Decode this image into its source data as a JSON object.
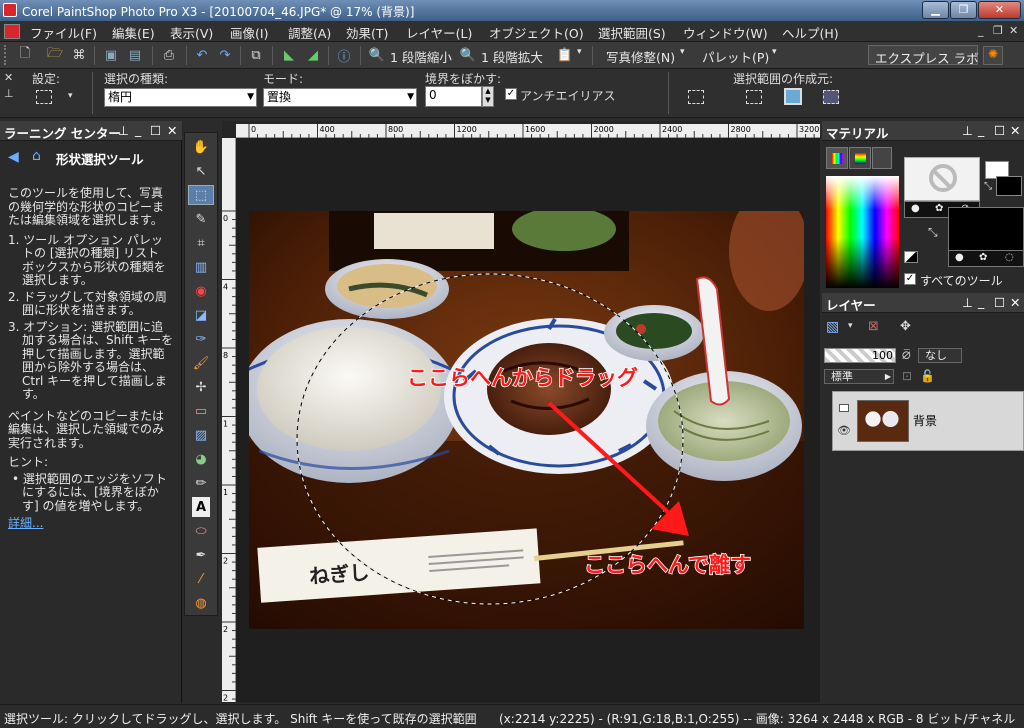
{
  "window": {
    "title": "Corel PaintShop Photo Pro X3 - [20100704_46.JPG* @  17% (背景)]",
    "minimize_icon": "minimize-icon",
    "maximize_icon": "maximize-icon",
    "close_icon": "close-icon"
  },
  "menu": {
    "items": [
      "ファイル(F)",
      "編集(E)",
      "表示(V)",
      "画像(I)",
      "調整(A)",
      "効果(T)",
      "レイヤー(L)",
      "オブジェクト(O)",
      "選択範囲(S)",
      "ウィンドウ(W)",
      "ヘルプ(H)"
    ]
  },
  "toolbar": {
    "zoom_out": "1 段階縮小",
    "zoom_in": "1 段階拡大",
    "photo_fix": "写真修整(N)",
    "palette": "パレット(P)",
    "express_lab": "エクスプレス ラボ"
  },
  "options": {
    "presets_label": "設定:",
    "selection_type_label": "選択の種類:",
    "selection_type_value": "楕円",
    "mode_label": "モード:",
    "mode_value": "置換",
    "feather_label": "境界をぼかす:",
    "feather_value": "0",
    "antialias_label": "アンチエイリアス",
    "antialias_checked": true,
    "create_from_label": "選択範囲の作成元:"
  },
  "learning": {
    "header": "ラーニング センター",
    "title": "形状選択ツール",
    "intro": "このツールを使用して、写真の幾何学的な形状のコピーまたは編集領域を選択します。",
    "steps": [
      "1. ツール オプション パレットの [選択の種類] リスト ボックスから形状の種類を選択します。",
      "2. ドラッグして対象領域の周囲に形状を描きます。",
      "3. オプション: 選択範囲に追加する場合は、Shift キーを押して描画します。選択範囲から除外する場合は、Ctrl キーを押して描画します。"
    ],
    "note": "ペイントなどのコピーまたは編集は、選択した領域でのみ実行されます。",
    "hint_label": "ヒント:",
    "hint": "選択範囲のエッジをソフトにするには、[境界をぼかす] の値を増やします。",
    "more_link": "詳細..."
  },
  "ruler": {
    "h_ticks": [
      "0",
      "400",
      "800",
      "1200",
      "1600",
      "2000",
      "2400",
      "2800",
      "3200"
    ],
    "v_ticks": [
      "0",
      "4",
      "8",
      "1",
      "1",
      "2",
      "2",
      "2"
    ]
  },
  "canvas": {
    "annotation_drag": "ここらへんからドラッグ",
    "annotation_release": "ここらへんで離す",
    "chopsticks_brand": "ねぎし"
  },
  "materials": {
    "header": "マテリアル",
    "all_tools_label": "すべてのツール",
    "all_tools_checked": true
  },
  "layers": {
    "header": "レイヤー",
    "opacity": "100",
    "blend_none": "なし",
    "blend_mode": "標準",
    "layer_name": "背景"
  },
  "status": {
    "text": "選択ツール: クリックしてドラッグし、選択します。 Shift キーを使って既存の選択範囲",
    "coords": "(x:2214 y:2225) - (R:91,G:18,B:1,O:255) -- 画像:  3264 x 2448 x RGB - 8 ビット/チャネル"
  },
  "colors": {
    "accent_red": "#ff1a1a",
    "panel_bg": "#2a2a2a",
    "title_blue": "#4a6a94"
  }
}
